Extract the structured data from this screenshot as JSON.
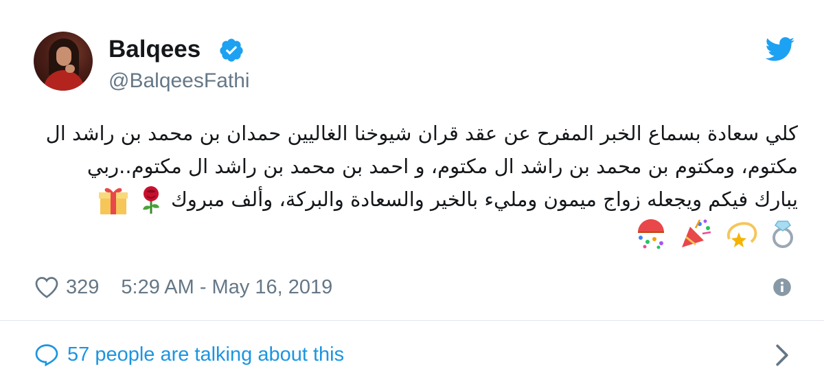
{
  "author": {
    "name": "Balqees",
    "handle": "@BalqeesFathi",
    "verified": true
  },
  "tweet": {
    "text_line1": "كلي سعادة بسماع الخبر المفرح عن عقد قران شيوخنا الغاليين حمدان بن محمد بن راشد ال",
    "text_line2": "مكتوم، ومكتوم بن محمد بن راشد ال مكتوم، و احمد بن محمد بن راشد ال مكتوم..ربي",
    "text_line3": "يبارك فيكم ويجعله زواج ميمون ومليء بالخير والسعادة والبركة، وألف مبروك",
    "emojis_line3": [
      "rose-emoji",
      "gift-emoji"
    ],
    "emojis_line4": [
      "ring-emoji",
      "dizzy-star-emoji",
      "party-popper-emoji",
      "confetti-ball-emoji"
    ]
  },
  "stats": {
    "likes": "329",
    "timestamp": "5:29 AM - May 16, 2019"
  },
  "footer": {
    "talking_text": "57 people are talking about this"
  },
  "colors": {
    "twitter_blue": "#1da1f2",
    "link_blue": "#1b95e0",
    "secondary_text": "#657786",
    "divider": "#e1e8ed"
  },
  "icons": [
    "twitter-bird-icon",
    "verified-badge-icon",
    "heart-icon",
    "info-icon",
    "speech-bubble-icon",
    "chevron-right-icon"
  ]
}
